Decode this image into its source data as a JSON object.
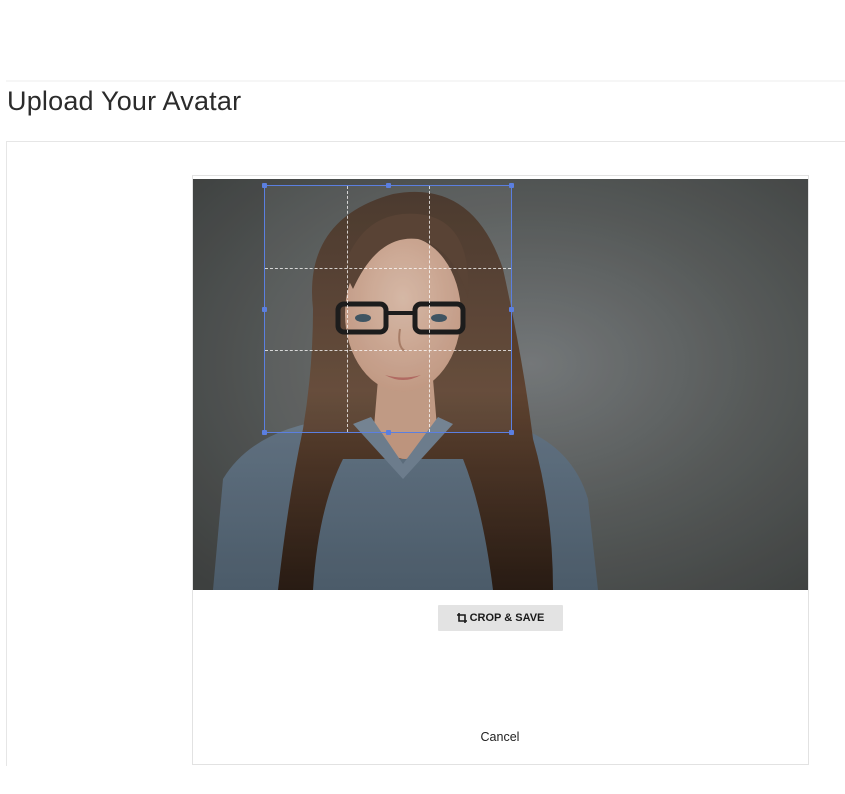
{
  "page": {
    "title": "Upload Your Avatar"
  },
  "cropper": {
    "image_description_icon": "portrait-photo",
    "crop_button_label": "CROP & SAVE",
    "crop_button_icon": "crop-icon",
    "cancel_label": "Cancel",
    "accent_color": "#5b7fe0"
  }
}
